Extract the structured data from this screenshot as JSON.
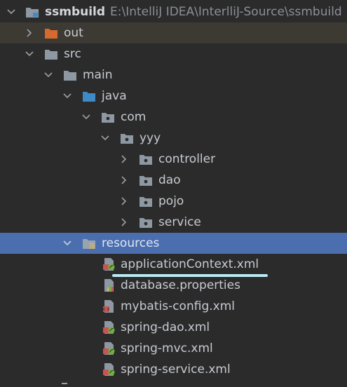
{
  "project": {
    "name": "ssmbuild",
    "path": "E:\\IntelliJ IDEA\\InterlliJ-Source\\ssmbuild"
  },
  "tree": {
    "out": "out",
    "src": "src",
    "main": "main",
    "java": "java",
    "com": "com",
    "yyy": "yyy",
    "controller": "controller",
    "dao": "dao",
    "pojo": "pojo",
    "service": "service",
    "resources": "resources"
  },
  "files": {
    "application_context": "applicationContext.xml",
    "database_properties": "database.properties",
    "mybatis_config": "mybatis-config.xml",
    "spring_dao": "spring-dao.xml",
    "spring_mvc": "spring-mvc.xml",
    "spring_service": "spring-service.xml"
  },
  "colors": {
    "background": "#2b2b2b",
    "selection": "#4b6eaf",
    "excluded_folder": "#d8692e",
    "source_folder": "#3d8ac7",
    "folder": "#8e98a3",
    "underline_annotation": "#b9ebf3"
  },
  "icons": {
    "expand": "chevron-down-icon",
    "collapsed": "chevron-right-icon",
    "folder": "folder-icon",
    "package": "package-icon",
    "resources": "resources-folder-icon",
    "spring_xml": "spring-xml-icon",
    "properties": "properties-file-icon",
    "xml": "xml-file-icon"
  }
}
